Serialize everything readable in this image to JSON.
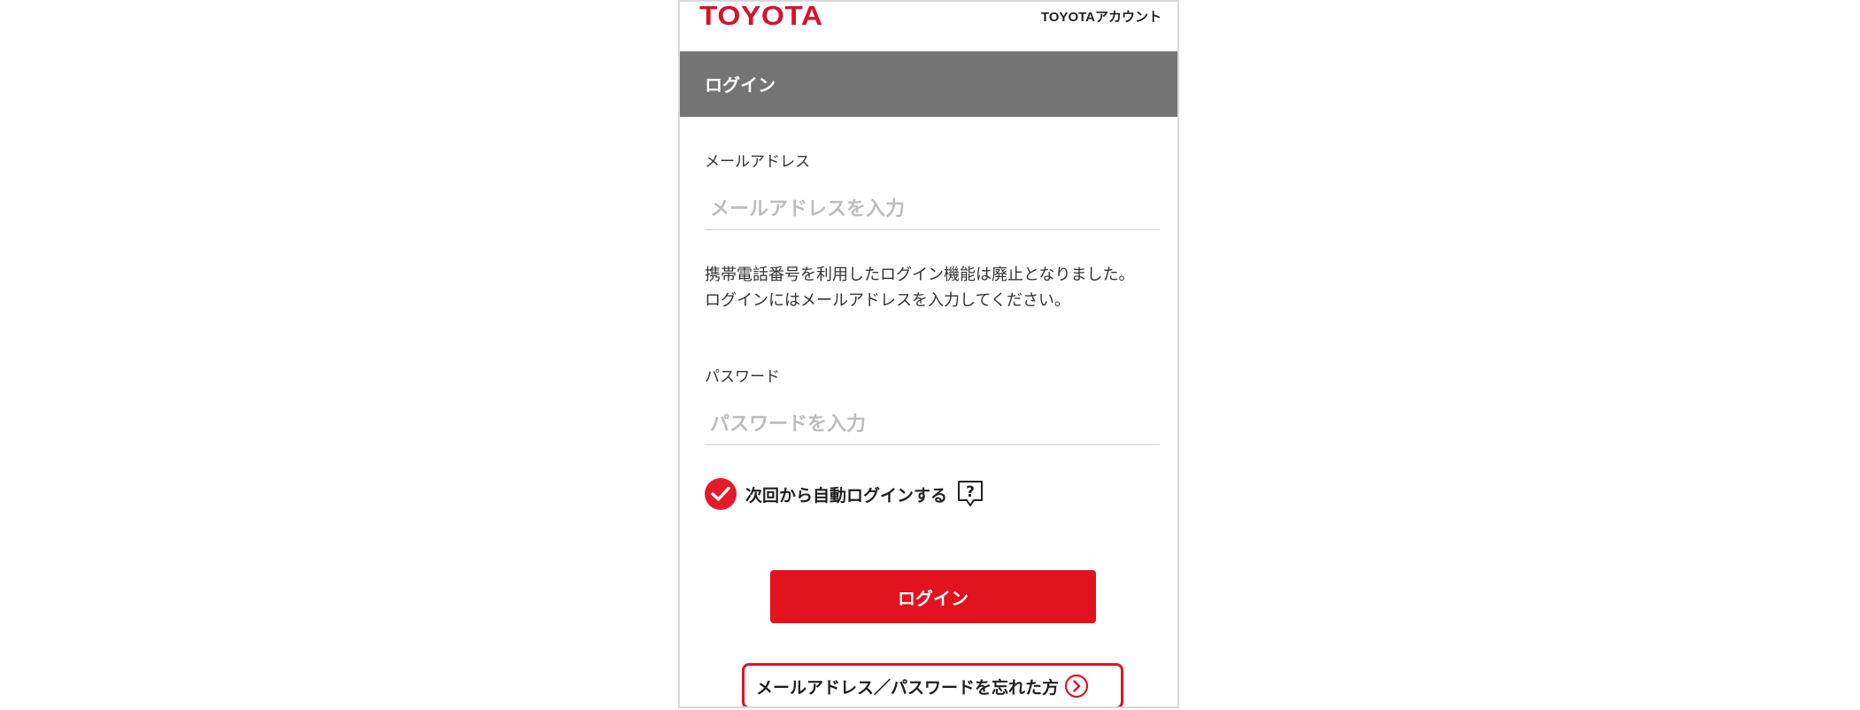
{
  "header": {
    "logo_text": "TOYOTA",
    "account_link": "TOYOTAアカウント"
  },
  "section": {
    "title": "ログイン"
  },
  "email": {
    "label": "メールアドレス",
    "placeholder": "メールアドレスを入力",
    "value": ""
  },
  "notice": {
    "line1": "携帯電話番号を利用したログイン機能は廃止となりました。",
    "line2": "ログインにはメールアドレスを入力してください。"
  },
  "password": {
    "label": "パスワード",
    "placeholder": "パスワードを入力",
    "value": ""
  },
  "auto_login": {
    "label": "次回から自動ログインする",
    "checked": true
  },
  "login_button": {
    "label": "ログイン"
  },
  "forgot": {
    "label": "メールアドレス／パスワードを忘れた方"
  },
  "colors": {
    "brand_red": "#e3121f",
    "logo_red": "#d7132b",
    "header_gray": "#747474",
    "placeholder_gray": "#bdbdbd"
  },
  "icons": {
    "check": "checkmark-icon",
    "help": "help-bubble-icon",
    "chevron": "chevron-right-circle-icon"
  }
}
